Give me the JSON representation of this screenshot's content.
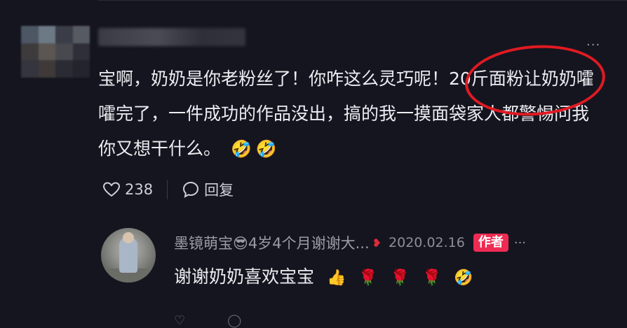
{
  "comment": {
    "text": "宝啊，奶奶是你老粉丝了！你咋这么灵巧呢！20斤面粉让奶奶嚯嚯完了，一件成功的作品没出，搞的我一摸面袋家人都警惕问我你又想干什么。",
    "emojis": [
      "🤣",
      "🤣"
    ],
    "like_count": "238",
    "reply_label": "回复",
    "more_icon": "more-dots-icon"
  },
  "reply": {
    "name": "墨镜萌宝😎4岁4个月谢谢大...",
    "date": "2020.02.16",
    "badge": "作者",
    "text": "谢谢奶奶喜欢宝宝",
    "emojis": [
      "👍",
      "🌹",
      "🌹",
      "🌹",
      "🤣"
    ]
  },
  "colors": {
    "background": "#15151f",
    "highlight_oval": "#e01a22",
    "author_badge": "#ee2b52"
  }
}
